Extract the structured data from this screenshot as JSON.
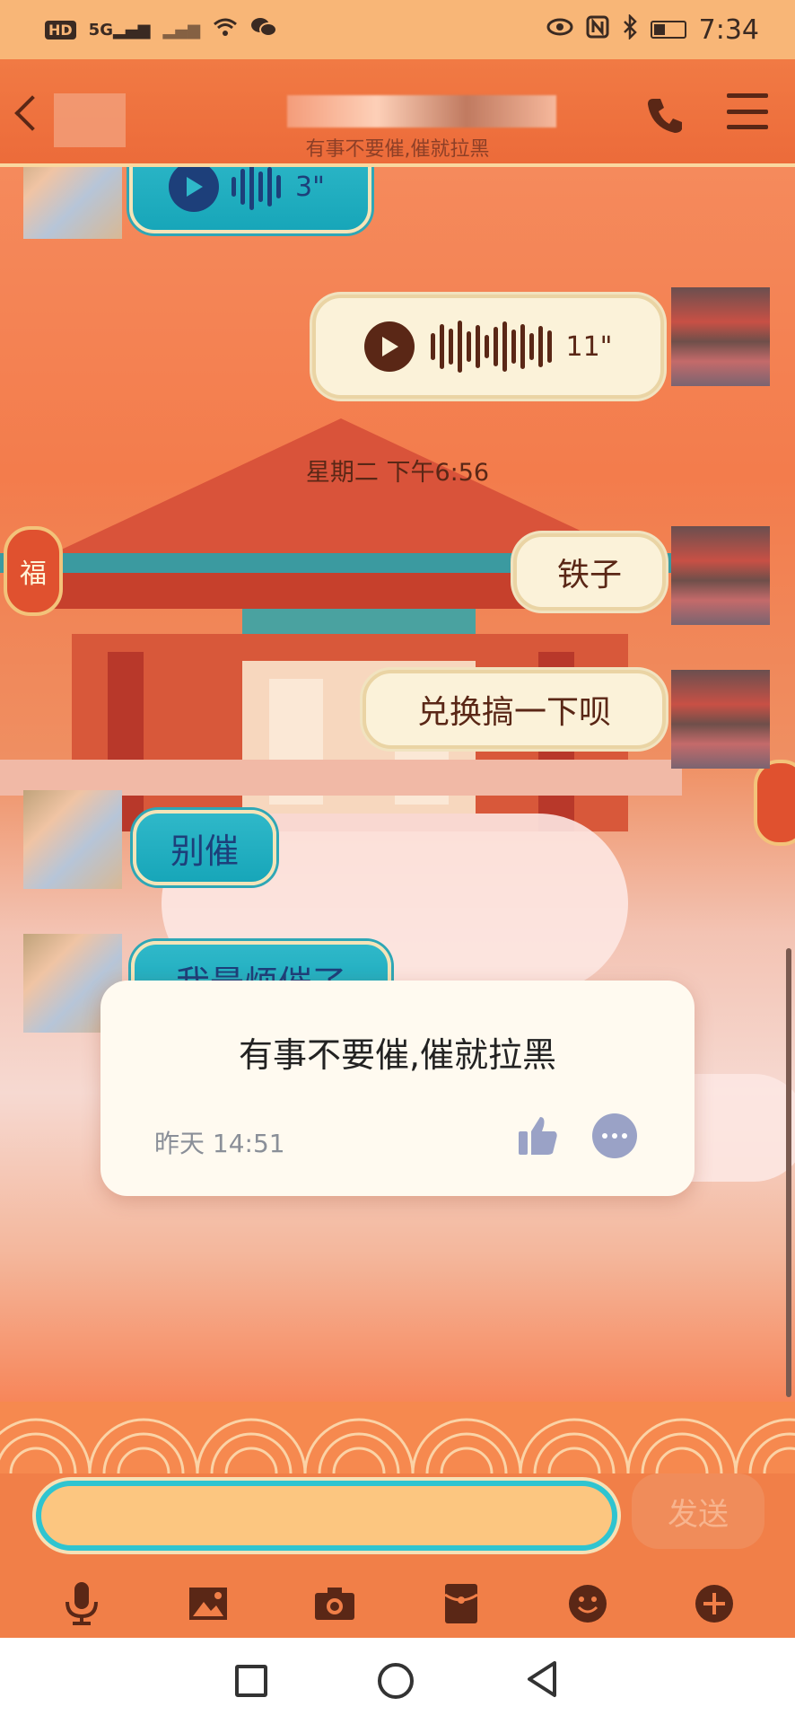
{
  "status_bar": {
    "left_chip": "HD",
    "signal_1": "5G",
    "time": "7:34"
  },
  "header": {
    "subtitle": "有事不要催,催就拉黑"
  },
  "messages": [
    {
      "side": "left",
      "type": "voice",
      "duration": "3\""
    },
    {
      "side": "right",
      "type": "voice",
      "duration": "11\""
    },
    {
      "side": "right",
      "type": "text",
      "text": "铁子"
    },
    {
      "side": "right",
      "type": "text",
      "text": "兑换搞一下呗"
    },
    {
      "side": "left",
      "type": "text",
      "text": "别催"
    },
    {
      "side": "left",
      "type": "text",
      "text": "我最烦催了"
    }
  ],
  "time_separator": "星期二 下午6:56",
  "notice": {
    "text": "有事不要催,催就拉黑",
    "time": "昨天 14:51"
  },
  "composer": {
    "input_value": "",
    "send_label": "发送"
  },
  "toolbar_icons": [
    "microphone-icon",
    "image-icon",
    "camera-icon",
    "red-packet-icon",
    "emoji-icon",
    "plus-icon"
  ],
  "colors": {
    "header": "#ec6b3a",
    "teal_bubble": "#17a6b9",
    "cream_bubble": "#fbf2d9",
    "icon_dark": "#5a2716"
  }
}
